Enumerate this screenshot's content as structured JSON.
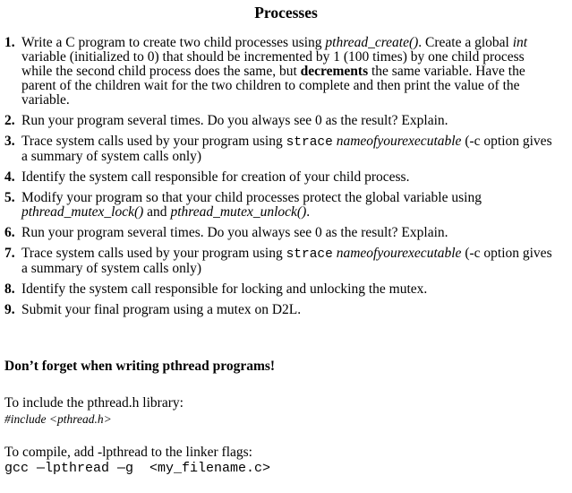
{
  "title": "Processes",
  "tasks": [
    {
      "num": "1.",
      "parts": {
        "a": "Write a C program to create two child processes using ",
        "b": "pthread_create()",
        "c": ". Create a global ",
        "d": "int",
        "e": " variable (initialized to 0) that should be incremented by 1 (100 times) by one child process while the second child process does the same, but ",
        "f": "decrements",
        "g": " the same variable. Have the parent of the children wait for the two children to complete and then print the value of the variable."
      }
    },
    {
      "num": "2.",
      "text": "Run your program several times. Do you always see 0 as the result? Explain."
    },
    {
      "num": "3.",
      "parts": {
        "a": "Trace system calls used by your program using ",
        "b": "strace",
        "c": " ",
        "d": "nameofyourexecutable",
        "e": " (-c option gives a summary of system calls only)"
      }
    },
    {
      "num": "4.",
      "text": "Identify the system call responsible for creation of your child process."
    },
    {
      "num": "5.",
      "parts": {
        "a": "Modify your program so that your child processes protect the global variable using ",
        "b": "pthread_mutex_lock()",
        "c": " and ",
        "d": "pthread_mutex_unlock()",
        "e": "."
      }
    },
    {
      "num": "6.",
      "text": "Run your program several times. Do you always see 0 as the result? Explain."
    },
    {
      "num": "7.",
      "parts": {
        "a": "Trace system calls used by your program using ",
        "b": "strace",
        "c": " ",
        "d": "nameofyourexecutable",
        "e": " (-c option gives a summary of system calls only)"
      }
    },
    {
      "num": "8.",
      "text": "Identify the system call responsible for locking and unlocking the mutex."
    },
    {
      "num": "9.",
      "text": "Submit your final program using a mutex on D2L."
    }
  ],
  "notes": {
    "heading": "Don’t forget when writing pthread programs!",
    "include_label": "To include the pthread.h library:",
    "include_code": "#include <pthread.h>",
    "compile_label": "To compile, add -lpthread to the linker flags:",
    "compile_code": "gcc —lpthread —g  <my_filename.c>"
  }
}
